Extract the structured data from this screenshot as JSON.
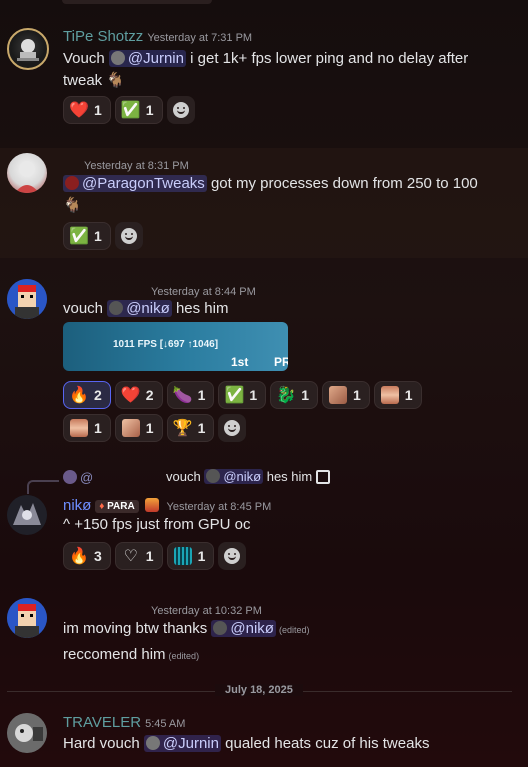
{
  "messages": [
    {
      "username": "TiPe Shotzz",
      "username_color": "#5f9ea0",
      "timestamp": "Yesterday at 7:31 PM",
      "text_pre": "Vouch",
      "mention": "@Jurnin",
      "text_post": "i get 1k+ fps lower ping and no delay after",
      "line2": "tweak",
      "reactions": [
        {
          "icon": "heart-emoji",
          "count": "1"
        },
        {
          "icon": "check-emoji",
          "count": "1"
        }
      ]
    },
    {
      "timestamp": "Yesterday at 8:31 PM",
      "mention": "@ParagonTweaks",
      "text_post": "got my processes down from 250 to 100",
      "reactions": [
        {
          "icon": "check-emoji",
          "count": "1"
        }
      ]
    },
    {
      "timestamp": "Yesterday at 8:44 PM",
      "text_pre": "vouch",
      "mention": "@nikø",
      "text_post": "hes him",
      "embed": {
        "stat": "1011 FPS [↓697 ↑1046]",
        "rank": "1st",
        "tag": "PR"
      },
      "reactions_row1": [
        {
          "icon": "fire-emoji",
          "count": "2"
        },
        {
          "icon": "heart-emoji",
          "count": "2"
        },
        {
          "icon": "eggplant-emoji",
          "count": "1"
        },
        {
          "icon": "check-emoji",
          "count": "1"
        },
        {
          "icon": "dragon-emoji",
          "count": "1"
        },
        {
          "icon": "custom-emoji-1",
          "count": "1"
        },
        {
          "icon": "custom-emoji-2",
          "count": "1"
        }
      ],
      "reactions_row2": [
        {
          "icon": "custom-emoji-3",
          "count": "1"
        },
        {
          "icon": "custom-emoji-4",
          "count": "1"
        },
        {
          "icon": "trophy-emoji",
          "count": "1"
        }
      ]
    },
    {
      "reply": {
        "at": "@",
        "text_pre": "vouch",
        "mention": "@nikø",
        "text_post": "hes him"
      },
      "username": "nikø",
      "username_color": "#6e8fff",
      "badge": "PARA",
      "timestamp": "Yesterday at 8:45 PM",
      "text": "^ +150 fps just from GPU oc",
      "reactions": [
        {
          "icon": "fire-emoji",
          "count": "3"
        },
        {
          "icon": "heart-outline-emoji",
          "count": "1"
        },
        {
          "icon": "custom-emoji-5",
          "count": "1"
        }
      ]
    },
    {
      "timestamp": "Yesterday at 10:32 PM",
      "text_pre": "im moving btw thanks",
      "mention": "@nikø",
      "edited": "(edited)",
      "line2": "reccomend him",
      "edited2": "(edited)"
    },
    {
      "username": "TRAVELER",
      "username_color": "#5f9ea0",
      "timestamp": "5:45 AM",
      "text_pre": "Hard vouch",
      "mention": "@Jurnin",
      "text_post": "qualed heats cuz of his tweaks"
    }
  ],
  "divider_label": "July 18, 2025",
  "colors": {
    "accent": "#5865f2",
    "mention_bg": "#3a3f7a"
  }
}
